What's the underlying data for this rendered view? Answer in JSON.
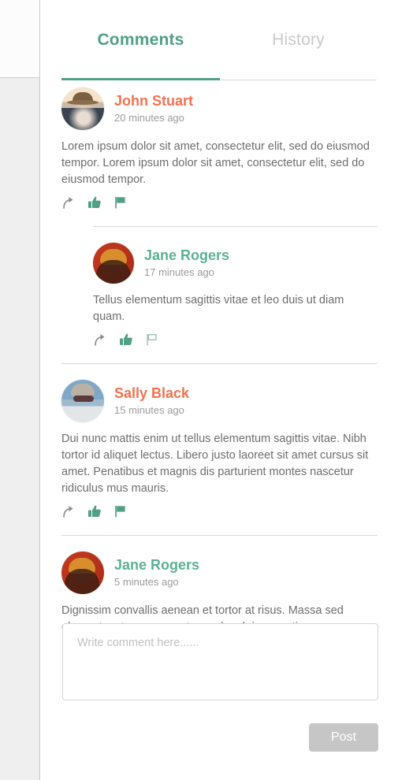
{
  "tabs": [
    {
      "label": "Comments",
      "active": true
    },
    {
      "label": "History",
      "active": false
    }
  ],
  "comments": [
    {
      "author": "John Stuart",
      "time": "20 minutes ago",
      "text": "Lorem ipsum dolor sit amet, consectetur elit, sed do eiusmod tempor. Lorem ipsum dolor sit amet, consectetur elit, sed do eiusmod tempor.",
      "name_color": "#f4714f",
      "actions": [
        "reply-icon",
        "thumbs-up-icon",
        "flag-icon"
      ]
    },
    {
      "author": "Jane Rogers",
      "time": "17 minutes ago",
      "text": "Tellus elementum sagittis vitae et leo duis ut diam quam.",
      "name_color": "#5bb292",
      "actions": [
        "reply-icon",
        "thumbs-up-icon",
        "flag-outline-icon"
      ]
    },
    {
      "author": "Sally Black",
      "time": "15 minutes ago",
      "text": "Dui nunc mattis enim ut tellus elementum sagittis vitae. Nibh tortor id aliquet lectus. Libero justo laoreet sit amet cursus sit amet. Penatibus et magnis dis parturient montes nascetur ridiculus mus mauris.",
      "name_color": "#f4714f",
      "actions": [
        "reply-icon",
        "thumbs-up-icon",
        "flag-icon"
      ]
    },
    {
      "author": "Jane Rogers",
      "time": "5 minutes ago",
      "text": "Dignissim convallis aenean et tortor at risus. Massa sed elementum tempus egestas sed sed risus pretium.",
      "name_color": "#5bb292",
      "actions": [
        "reply-icon",
        "thumbs-up-icon",
        "flag-outline-icon"
      ]
    }
  ],
  "composer": {
    "placeholder": "Write comment here......",
    "value": "",
    "post_label": "Post"
  },
  "colors": {
    "accent_green": "#4fa086",
    "accent_orange": "#f4714f",
    "body_text": "#6d6d6d",
    "muted_text": "#9b9b9b",
    "inactive_tab": "#c9c9c9",
    "divider": "#d9d9d9",
    "post_button": "#c6c6c6"
  }
}
